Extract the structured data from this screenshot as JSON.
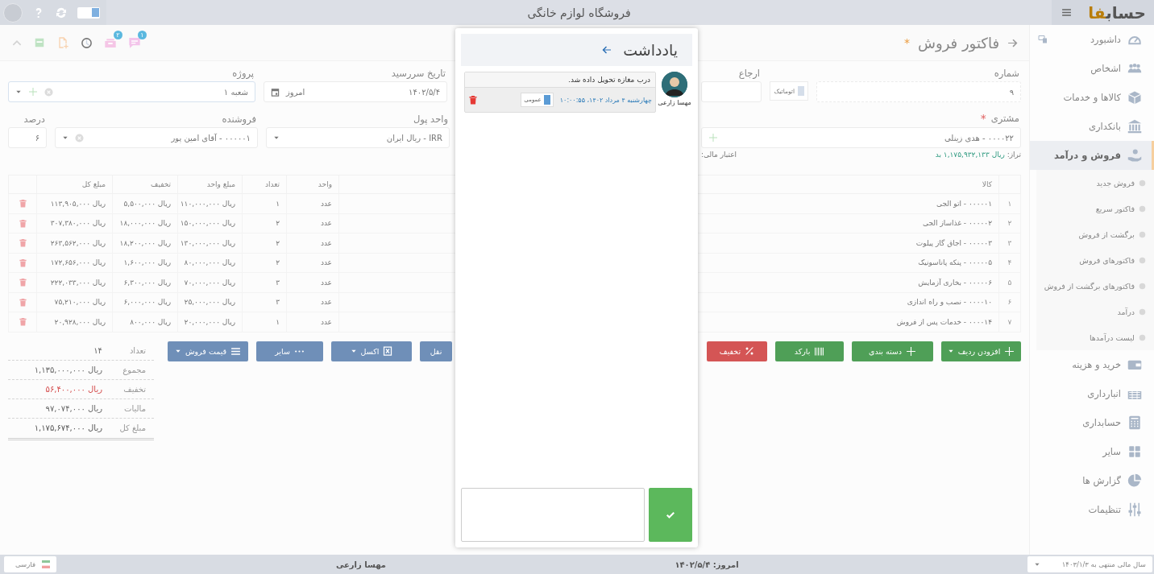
{
  "topbar": {
    "title": "فروشگاه لوازم خانگی",
    "logo_main": "حساب",
    "logo_accent": "فا",
    "toggle_on": true
  },
  "sidebar": {
    "items": [
      {
        "label": "داشبورد",
        "selected": false
      },
      {
        "label": "اشخاص",
        "selected": false
      },
      {
        "label": "کالاها و خدمات",
        "selected": false
      },
      {
        "label": "بانکداری",
        "selected": false
      },
      {
        "label": "فروش و درآمد",
        "selected": true,
        "expanded": true,
        "children": [
          {
            "label": "فروش جدید"
          },
          {
            "label": "فاکتور سریع"
          },
          {
            "label": "برگشت از فروش"
          },
          {
            "label": "فاکتورهای فروش"
          },
          {
            "label": "فاکتورهای برگشت از فروش"
          },
          {
            "label": "درآمد"
          },
          {
            "label": "لیست درآمدها"
          }
        ]
      },
      {
        "label": "خرید و هزینه",
        "selected": false
      },
      {
        "label": "انبارداری",
        "selected": false
      },
      {
        "label": "حسابداری",
        "selected": false
      },
      {
        "label": "سایر",
        "selected": false
      },
      {
        "label": "گزارش ها",
        "selected": false
      },
      {
        "label": "تنظیمات",
        "selected": false
      }
    ]
  },
  "toolbar": {
    "queue_badge": "۲",
    "chat_badge": "۱"
  },
  "header": {
    "title": "فاکتور فروش",
    "required_mark": "*"
  },
  "form": {
    "number": {
      "label": "شماره",
      "value": "۹",
      "auto_label": "اتوماتیک"
    },
    "reference": {
      "label": "ارجاع"
    },
    "due_date": {
      "label": "تاریخ سررسید",
      "value": "۱۴۰۲/۵/۴",
      "hint": "امروز"
    },
    "project": {
      "label": "پروژه",
      "value": "شعبه ۱"
    },
    "customer": {
      "label": "مشتری",
      "required_mark": "*",
      "value": "۰۰۰۰۲۲ - هدی زینلی",
      "balance_label": "تراز:",
      "balance": "ریال ۱,۱۷۵,۹۳۲,۱۳۳ بد",
      "credit_label": "اعتبار مالی:"
    },
    "currency": {
      "label": "واحد پول",
      "value": "IRR - ریال ایران"
    },
    "seller": {
      "label": "فروشنده",
      "value": "۰۰۰۰۰۱ - آقای امین پور"
    },
    "percent": {
      "label": "درصد",
      "value": "۶"
    }
  },
  "table": {
    "columns": [
      "کالا",
      "واحد",
      "تعداد",
      "مبلغ واحد",
      "تخفیف",
      "مبلغ کل"
    ],
    "rows": [
      {
        "index": "۱",
        "item": "۰۰۰۰۰۱ - اتو الجی",
        "unit": "عدد",
        "qty": "۱",
        "unit_price": "ریال ۱۱۰,۰۰۰,۰۰۰",
        "discount": "ریال ۵,۵۰۰,۰۰۰",
        "total": "ریال ۱۱۳,۹۰۵,۰۰۰"
      },
      {
        "index": "۲",
        "item": "۰۰۰۰۰۲ - غذاساز الجی",
        "unit": "عدد",
        "qty": "۲",
        "unit_price": "ریال ۱۵۰,۰۰۰,۰۰۰",
        "discount": "ریال ۱۸,۰۰۰,۰۰۰",
        "total": "ریال ۳۰۷,۳۸۰,۰۰۰"
      },
      {
        "index": "۳",
        "item": "۰۰۰۰۰۳ - اجاق گاز پیلوت",
        "unit": "عدد",
        "qty": "۲",
        "unit_price": "ریال ۱۳۰,۰۰۰,۰۰۰",
        "discount": "ریال ۱۸,۲۰۰,۰۰۰",
        "total": "ریال ۲۶۳,۵۶۲,۰۰۰"
      },
      {
        "index": "۴",
        "item": "۰۰۰۰۰۵ - پنکه پاناسونیک",
        "unit": "عدد",
        "qty": "۲",
        "unit_price": "ریال ۸۰,۰۰۰,۰۰۰",
        "discount": "ریال ۱,۶۰۰,۰۰۰",
        "total": "ریال ۱۷۲,۶۵۶,۰۰۰"
      },
      {
        "index": "۵",
        "item": "۰۰۰۰۰۶ - بخاری آزمایش",
        "unit": "عدد",
        "qty": "۳",
        "unit_price": "ریال ۷۰,۰۰۰,۰۰۰",
        "discount": "ریال ۶,۳۰۰,۰۰۰",
        "total": "ریال ۲۲۲,۰۳۳,۰۰۰"
      },
      {
        "index": "۶",
        "item": "۰۰۰۰۱۰ - نصب و راه اندازی",
        "unit": "عدد",
        "qty": "۳",
        "unit_price": "ریال ۲۵,۰۰۰,۰۰۰",
        "discount": "ریال ۶,۰۰۰,۰۰۰",
        "total": "ریال ۷۵,۲۱۰,۰۰۰"
      },
      {
        "index": "۷",
        "item": "۰۰۰۰۱۴ - خدمات پس از فروش",
        "unit": "عدد",
        "qty": "۱",
        "unit_price": "ریال ۲۰,۰۰۰,۰۰۰",
        "discount": "ریال ۸۰۰,۰۰۰",
        "total": "ریال ۲۰,۹۲۸,۰۰۰"
      }
    ]
  },
  "right_buttons": [
    {
      "label": "افزودن ردیف",
      "kind": "add",
      "dropdown": true
    },
    {
      "label": "دسته بندی",
      "kind": "group",
      "dropdown": false
    },
    {
      "label": "بارکد",
      "kind": "barcode",
      "dropdown": false
    },
    {
      "label": "تخفیف",
      "kind": "discount",
      "dropdown": false
    }
  ],
  "left_buttons": [
    {
      "label": "نقل",
      "kind": "transfer",
      "dropdown": false
    },
    {
      "label": "اکسل",
      "kind": "excel",
      "dropdown": true
    },
    {
      "label": "سایر",
      "kind": "other",
      "dropdown": false
    },
    {
      "label": "قیمت فروش",
      "kind": "price",
      "dropdown": true
    }
  ],
  "totals": [
    {
      "label": "تعداد",
      "value": "۱۴",
      "kind": "plain"
    },
    {
      "label": "مجموع",
      "value": "ریال ۱,۱۳۵,۰۰۰,۰۰۰",
      "kind": "plain"
    },
    {
      "label": "تخفیف",
      "value": "ریال ۵۶,۴۰۰,۰۰۰",
      "kind": "negative"
    },
    {
      "label": "مالیات",
      "value": "ریال ۹۷,۰۷۴,۰۰۰",
      "kind": "plain"
    },
    {
      "label": "مبلغ کل",
      "value": "ریال ۱,۱۷۵,۶۷۴,۰۰۰",
      "kind": "grand"
    }
  ],
  "modal": {
    "title": "یادداشت",
    "notes": [
      {
        "author": "مهسا زارعی",
        "text": "درب مغازه تحویل داده شد.",
        "date": "چهارشنبه ۴ مرداد ۱۴۰۲، ۱۰:۰۰:۵۵",
        "tag": "عمومی"
      }
    ]
  },
  "footer": {
    "fiscal_year": "سال مالی منتهی به ۱۴۰۳/۱/۳",
    "today": "امروز: ۱۴۰۲/۵/۴",
    "user": "مهسا زارعی",
    "language": "فارسی"
  }
}
